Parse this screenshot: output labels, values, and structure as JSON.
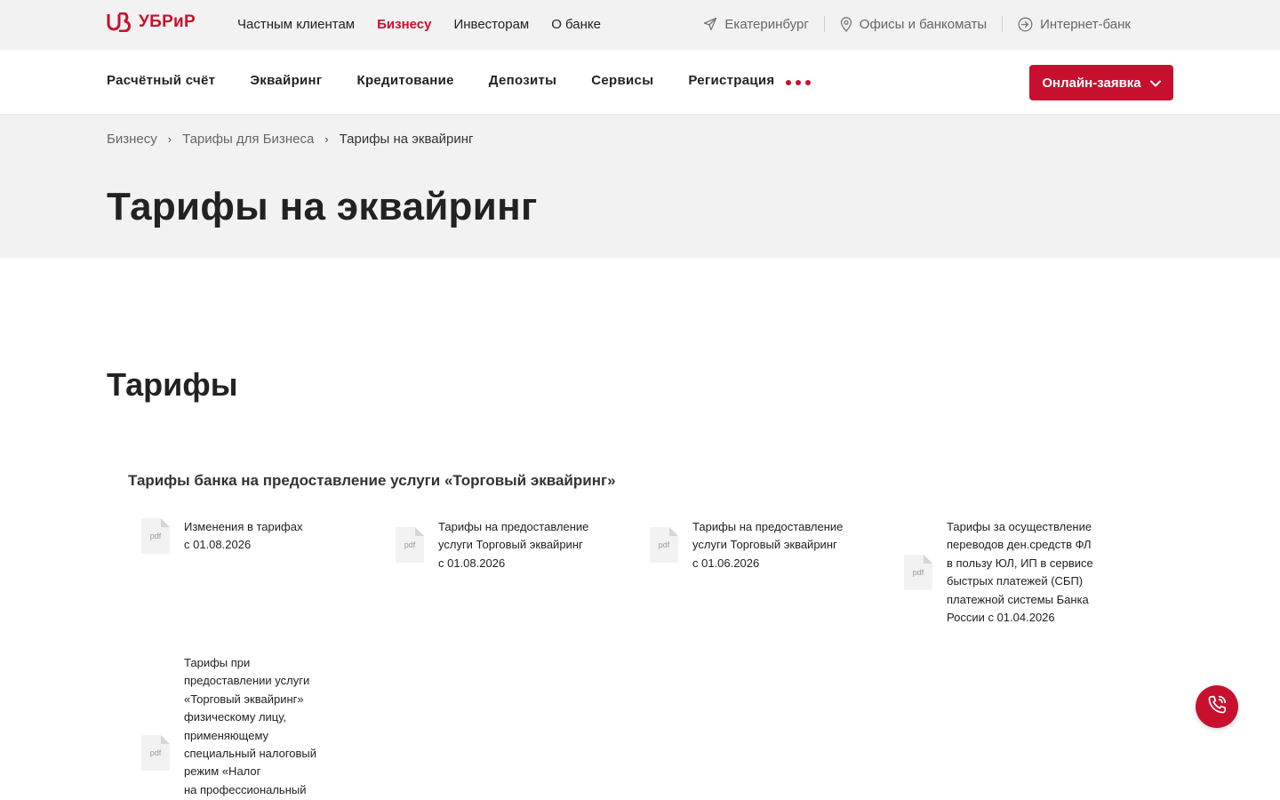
{
  "brand": {
    "name": "УБРиР",
    "accent": "#c8102e"
  },
  "top_nav": [
    {
      "label": "Частным клиентам",
      "active": false
    },
    {
      "label": "Бизнесу",
      "active": true
    },
    {
      "label": "Инвесторам",
      "active": false
    },
    {
      "label": "О банке",
      "active": false
    }
  ],
  "top_right": {
    "city": "Екатеринбург",
    "offices": "Офисы и банкоматы",
    "internet_bank": "Интернет-банк"
  },
  "main_nav": [
    "Расчётный счёт",
    "Эквайринг",
    "Кредитование",
    "Депозиты",
    "Сервисы",
    "Регистрация"
  ],
  "cta_label": "Онлайн-заявка",
  "breadcrumb": {
    "items": [
      "Бизнесу",
      "Тарифы для Бизнеса"
    ],
    "current": "Тарифы на эквайринг"
  },
  "page_title": "Тарифы на эквайринг",
  "section_title": "Тарифы",
  "group_title": "Тарифы банка на предоставление услуги «Торговый эквайринг»",
  "doc_ext": "pdf",
  "documents": [
    {
      "lines": [
        "Изменения в тарифах",
        "с 01.08.2026"
      ]
    },
    {
      "lines": [
        "Тарифы на предоставление",
        "услуги Торговый эквайринг",
        "с 01.08.2026"
      ]
    },
    {
      "lines": [
        "Тарифы на предоставление",
        "услуги Торговый эквайринг",
        "с 01.06.2026"
      ]
    },
    {
      "lines": [
        "Тарифы за осуществление",
        "переводов ден.средств ФЛ",
        "в пользу ЮЛ, ИП в сервисе",
        "быстрых платежей (СБП)",
        "платежной системы Банка",
        "России с 01.04.2026"
      ]
    },
    {
      "lines": [
        "Тарифы при",
        "предоставлении услуги",
        "«Торговый эквайринг»",
        "физическому лицу,",
        "применяющему",
        "специальный налоговый",
        "режим «Налог",
        "на профессиональный"
      ]
    }
  ]
}
